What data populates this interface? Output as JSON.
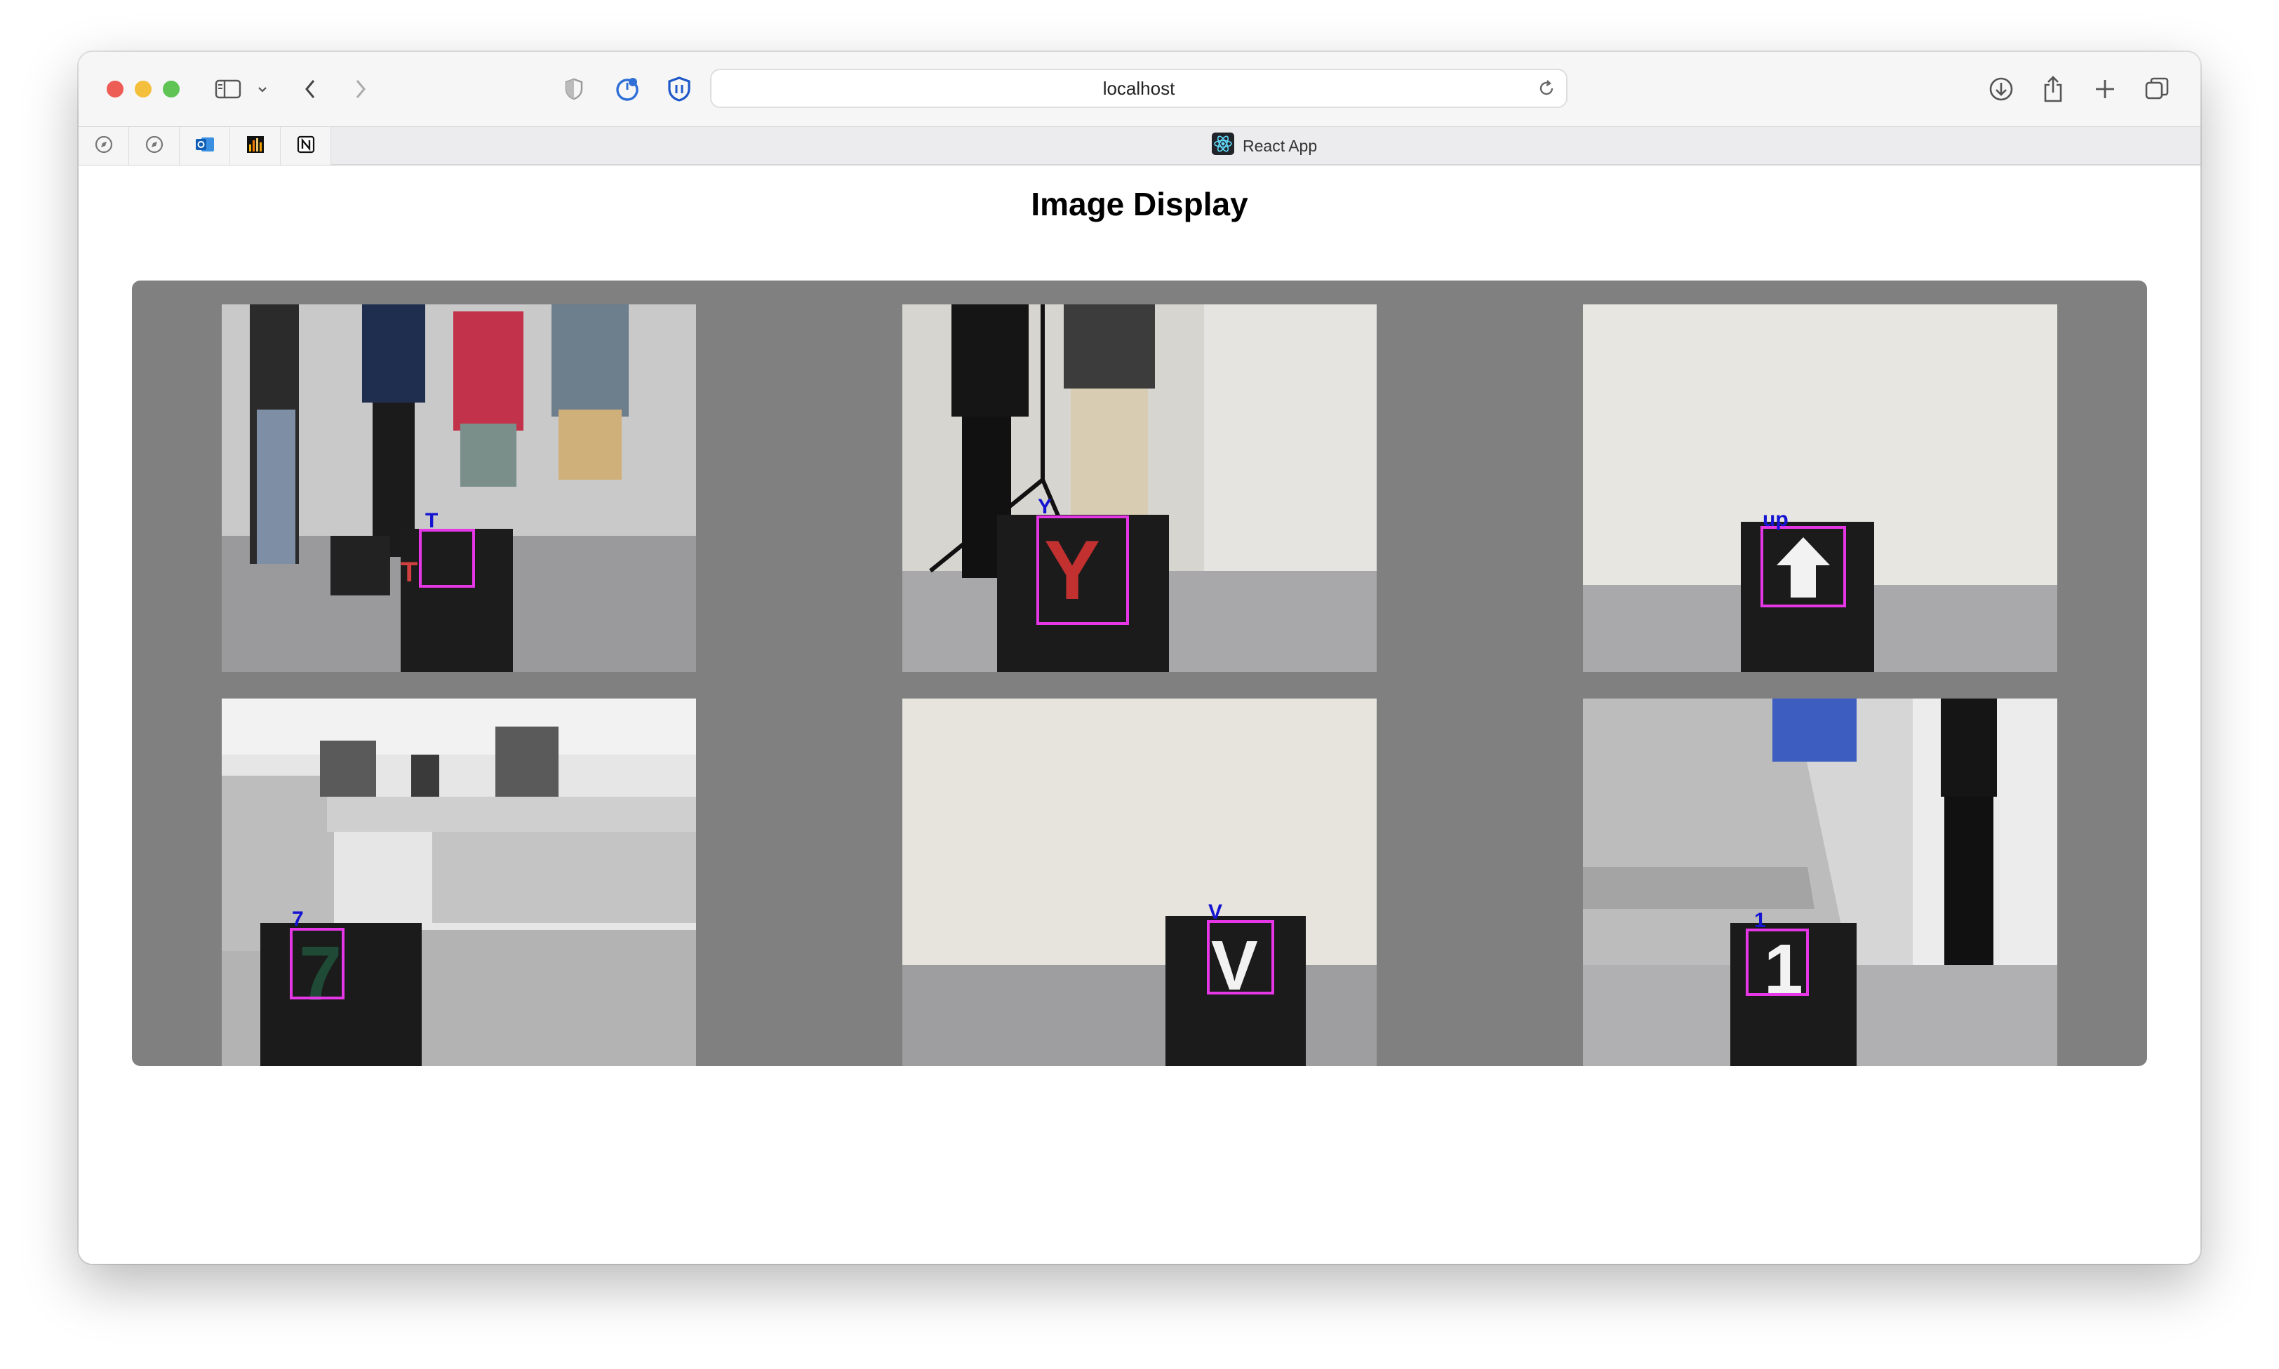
{
  "browser": {
    "url": "localhost",
    "tab_title": "React App"
  },
  "page": {
    "title": "Image Display"
  },
  "images": [
    {
      "label": "T"
    },
    {
      "label": "Y"
    },
    {
      "label": "up"
    },
    {
      "label": "7"
    },
    {
      "label": "V"
    },
    {
      "label": "1"
    }
  ],
  "colors": {
    "panel": "#808080",
    "box": "#e637e6",
    "label": "#1414d2"
  }
}
